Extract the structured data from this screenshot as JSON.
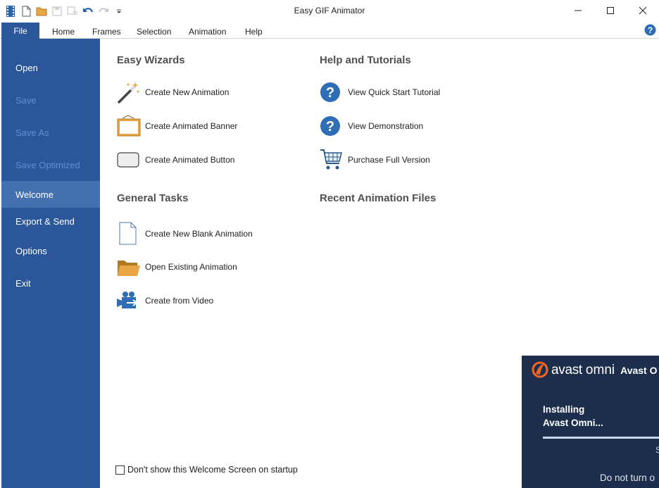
{
  "window": {
    "title": "Easy GIF Animator"
  },
  "ribbon": {
    "file_label": "File",
    "tabs": [
      "Home",
      "Frames",
      "Selection",
      "Animation",
      "Help"
    ]
  },
  "sidebar": {
    "items": [
      {
        "label": "Open",
        "state": "enabled"
      },
      {
        "label": "Save",
        "state": "disabled"
      },
      {
        "label": "Save As",
        "state": "disabled"
      },
      {
        "label": "Save Optimized",
        "state": "disabled"
      },
      {
        "label": "Welcome",
        "state": "active"
      },
      {
        "label": "Export & Send",
        "state": "enabled"
      },
      {
        "label": "Options",
        "state": "enabled"
      },
      {
        "label": "Exit",
        "state": "enabled"
      }
    ]
  },
  "wizards": {
    "title": "Easy Wizards",
    "items": [
      {
        "label": "Create New Animation",
        "icon": "magic-wand-icon"
      },
      {
        "label": "Create Animated Banner",
        "icon": "banner-icon"
      },
      {
        "label": "Create Animated Button",
        "icon": "button-shape-icon"
      }
    ]
  },
  "tasks": {
    "title": "General Tasks",
    "items": [
      {
        "label": "Create New Blank Animation",
        "icon": "blank-page-icon"
      },
      {
        "label": "Open Existing Animation",
        "icon": "folder-icon"
      },
      {
        "label": "Create from Video",
        "icon": "video-camera-icon"
      }
    ]
  },
  "help": {
    "title": "Help and Tutorials",
    "items": [
      {
        "label": "View Quick Start Tutorial",
        "icon": "question-icon"
      },
      {
        "label": "View Demonstration",
        "icon": "question-icon"
      },
      {
        "label": "Purchase Full Version",
        "icon": "shopping-cart-icon"
      }
    ]
  },
  "recent": {
    "title": "Recent Animation Files"
  },
  "startup_checkbox": {
    "label": "Don't show this Welcome Screen on startup",
    "checked": false
  },
  "avast_popup": {
    "brand": "avast",
    "product": "omni",
    "title": "Avast O",
    "status_line1": "Installing",
    "status_line2": "Avast Omni...",
    "progress_fraction": 1.0,
    "trailing_text": "S",
    "warning": "Do not turn o"
  },
  "colors": {
    "accent": "#2b579a",
    "sidebar_active": "#4470b0",
    "sidebar_disabled_text": "#5f8fd4",
    "help_blue": "#2f6db5",
    "folder_orange": "#e8a645",
    "avast_orange": "#f26522",
    "avast_bg": "#1d2e4c"
  }
}
